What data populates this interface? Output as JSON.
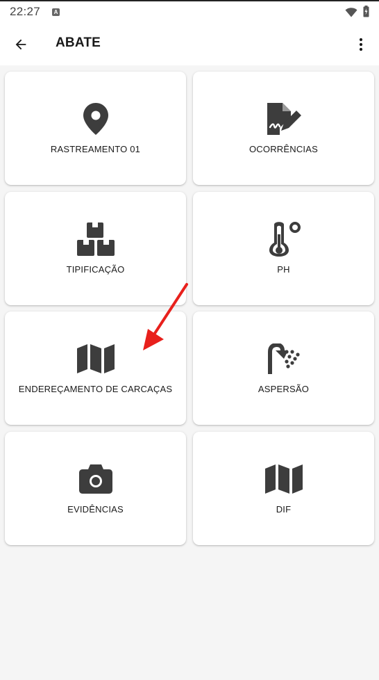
{
  "status_bar": {
    "time": "22:27",
    "a_badge": "A"
  },
  "app_bar": {
    "title": "ABATE",
    "back_icon": "arrow-back-icon",
    "menu_icon": "more-vert-icon"
  },
  "menu": {
    "items": [
      {
        "label": "RASTREAMENTO 01",
        "icon": "location-pin-icon"
      },
      {
        "label": "OCORRÊNCIAS",
        "icon": "signed-document-icon"
      },
      {
        "label": "TIPIFICAÇÃO",
        "icon": "boxes-icon"
      },
      {
        "label": "PH",
        "icon": "thermometer-icon"
      },
      {
        "label": "ENDEREÇAMENTO DE CARCAÇAS",
        "icon": "map-icon"
      },
      {
        "label": "ASPERSÃO",
        "icon": "shower-icon"
      },
      {
        "label": "EVIDÊNCIAS",
        "icon": "camera-icon"
      },
      {
        "label": "DIF",
        "icon": "map-icon"
      }
    ]
  },
  "colors": {
    "icon": "#3d3d3d",
    "annotation_arrow": "#e8201c",
    "background": "#f5f5f5",
    "card": "#ffffff"
  }
}
